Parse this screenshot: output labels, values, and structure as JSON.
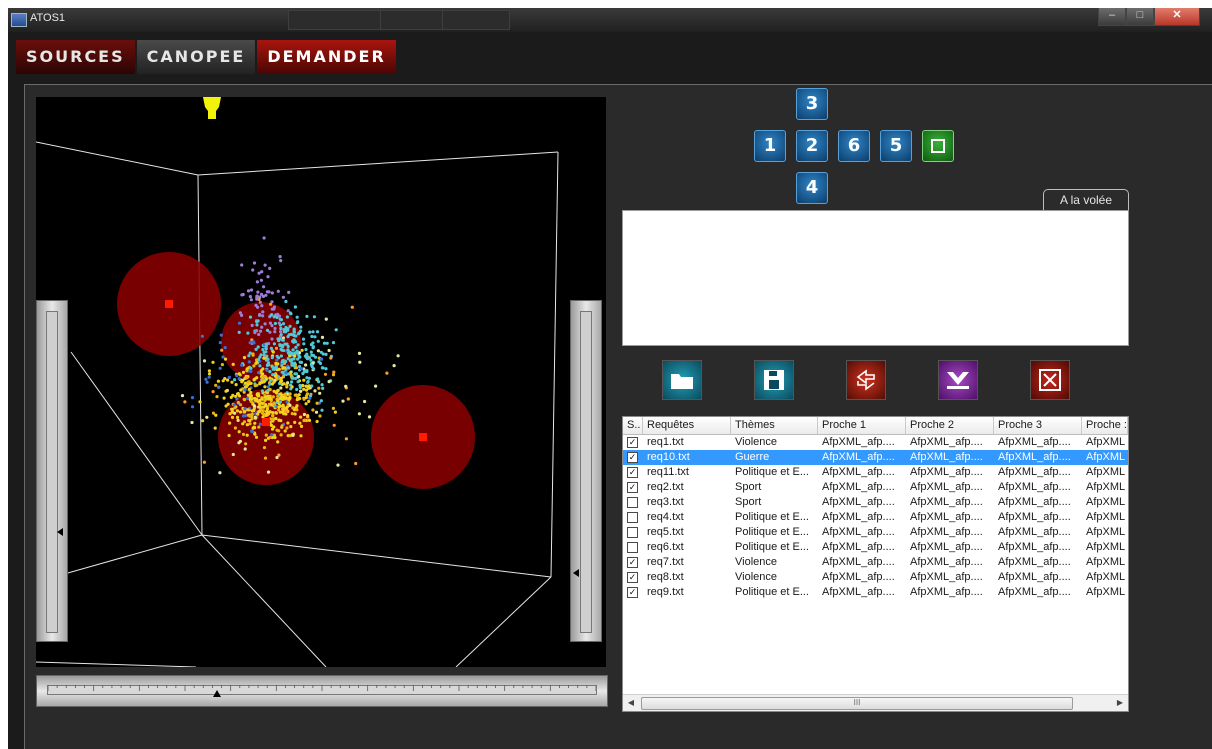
{
  "window": {
    "title": "ATOS1",
    "controls": {
      "minimize": "–",
      "maximize": "□",
      "close": "✕"
    }
  },
  "menu": {
    "tabs": [
      {
        "label": "SOURCES"
      },
      {
        "label": "CANOPEE"
      },
      {
        "label": "DEMANDER",
        "active": true
      }
    ]
  },
  "view_controls": {
    "buttons": [
      "3",
      "1",
      "2",
      "6",
      "5",
      "4"
    ],
    "center_icon": "square-icon"
  },
  "text_area": {
    "tab_label": "A la volée",
    "value": ""
  },
  "toolbar": {
    "icons": [
      "folder-icon",
      "save-icon",
      "arrows-icon",
      "download-icon",
      "delete-icon"
    ]
  },
  "table": {
    "columns": [
      "S..",
      "Requêtes",
      "Thèmes",
      "Proche 1",
      "Proche 2",
      "Proche 3",
      "Proche :"
    ],
    "rows": [
      {
        "checked": true,
        "file": "req1.txt",
        "theme": "Violence",
        "p1": "AfpXML_afp....",
        "p2": "AfpXML_afp....",
        "p3": "AfpXML_afp....",
        "p4": "AfpXML"
      },
      {
        "checked": true,
        "file": "req10.txt",
        "theme": "Guerre",
        "p1": "AfpXML_afp....",
        "p2": "AfpXML_afp....",
        "p3": "AfpXML_afp....",
        "p4": "AfpXML",
        "selected": true
      },
      {
        "checked": true,
        "file": "req11.txt",
        "theme": "Politique et E...",
        "p1": "AfpXML_afp....",
        "p2": "AfpXML_afp....",
        "p3": "AfpXML_afp....",
        "p4": "AfpXML"
      },
      {
        "checked": true,
        "file": "req2.txt",
        "theme": "Sport",
        "p1": "AfpXML_afp....",
        "p2": "AfpXML_afp....",
        "p3": "AfpXML_afp....",
        "p4": "AfpXML"
      },
      {
        "checked": false,
        "file": "req3.txt",
        "theme": "Sport",
        "p1": "AfpXML_afp....",
        "p2": "AfpXML_afp....",
        "p3": "AfpXML_afp....",
        "p4": "AfpXML"
      },
      {
        "checked": false,
        "file": "req4.txt",
        "theme": "Politique et E...",
        "p1": "AfpXML_afp....",
        "p2": "AfpXML_afp....",
        "p3": "AfpXML_afp....",
        "p4": "AfpXML"
      },
      {
        "checked": false,
        "file": "req5.txt",
        "theme": "Politique et E...",
        "p1": "AfpXML_afp....",
        "p2": "AfpXML_afp....",
        "p3": "AfpXML_afp....",
        "p4": "AfpXML"
      },
      {
        "checked": false,
        "file": "req6.txt",
        "theme": "Politique et E...",
        "p1": "AfpXML_afp....",
        "p2": "AfpXML_afp....",
        "p3": "AfpXML_afp....",
        "p4": "AfpXML"
      },
      {
        "checked": true,
        "file": "req7.txt",
        "theme": "Violence",
        "p1": "AfpXML_afp....",
        "p2": "AfpXML_afp....",
        "p3": "AfpXML_afp....",
        "p4": "AfpXML"
      },
      {
        "checked": true,
        "file": "req8.txt",
        "theme": "Violence",
        "p1": "AfpXML_afp....",
        "p2": "AfpXML_afp....",
        "p3": "AfpXML_afp....",
        "p4": "AfpXML"
      },
      {
        "checked": true,
        "file": "req9.txt",
        "theme": "Politique et E...",
        "p1": "AfpXML_afp....",
        "p2": "AfpXML_afp....",
        "p3": "AfpXML_afp....",
        "p4": "AfpXML"
      }
    ],
    "scroll_left": "◀",
    "scroll_right": "▶",
    "scroll_grip": "III"
  },
  "sliders": {
    "left_level": 0.69,
    "right_level": 0.82,
    "bottom_level": 0.31
  },
  "colors": {
    "sphere": "#8a0000",
    "sphere_center": "#ff1a00",
    "marker": "#f2f20a",
    "selection": "#3399ff",
    "points": [
      "#f2d21a",
      "#e8b40f",
      "#4ec9d6",
      "#9c7ed8",
      "#3a6fd8",
      "#e6e6a0",
      "#ff9a2a"
    ]
  }
}
